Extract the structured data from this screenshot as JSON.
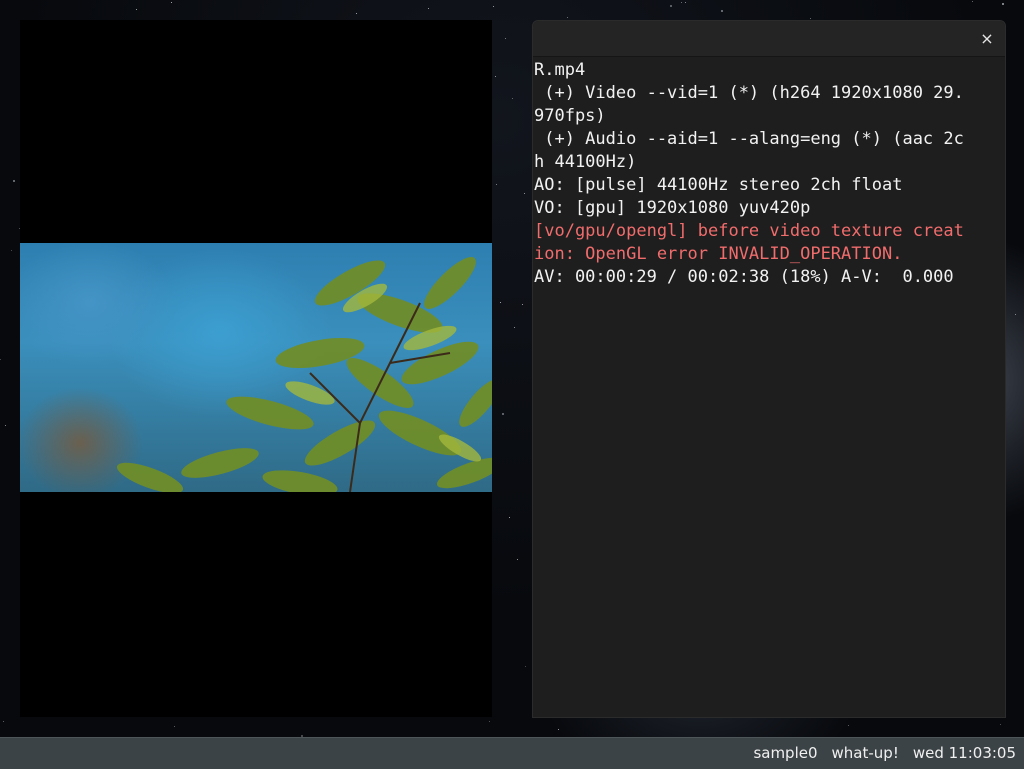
{
  "desktop": {
    "background": "starfield-nebula"
  },
  "player": {
    "icon": "video-frame-leaves"
  },
  "console": {
    "close_icon": "×",
    "lines": [
      {
        "text": "R.mp4",
        "type": "normal"
      },
      {
        "text": " (+) Video --vid=1 (*) (h264 1920x1080 29.",
        "type": "normal"
      },
      {
        "text": "970fps)",
        "type": "normal"
      },
      {
        "text": " (+) Audio --aid=1 --alang=eng (*) (aac 2c",
        "type": "normal"
      },
      {
        "text": "h 44100Hz)",
        "type": "normal"
      },
      {
        "text": "AO: [pulse] 44100Hz stereo 2ch float",
        "type": "normal"
      },
      {
        "text": "VO: [gpu] 1920x1080 yuv420p",
        "type": "normal"
      },
      {
        "text": "[vo/gpu/opengl] before video texture creat",
        "type": "error"
      },
      {
        "text": "ion: OpenGL error INVALID_OPERATION.",
        "type": "error"
      },
      {
        "text": "AV: 00:00:29 / 00:02:38 (18%) A-V:  0.000",
        "type": "normal"
      }
    ],
    "error_color": "#f16c6c",
    "text_color": "#f2f2f2"
  },
  "panel": {
    "items": [
      "sample0",
      "what-up!",
      "wed 11:03:05"
    ]
  }
}
